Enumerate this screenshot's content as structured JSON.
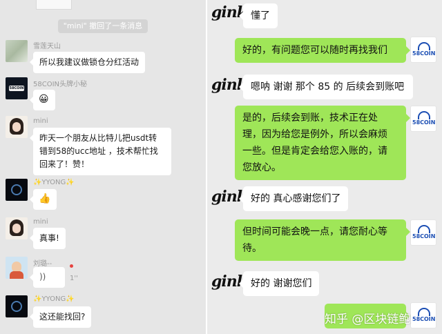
{
  "left": {
    "system_notice": "\"mini\" 撤回了一条消息",
    "messages": [
      {
        "sender": "雪莲天山",
        "text": "所以我建议做锁仓分红活动"
      },
      {
        "sender": "58COIN头牌小秘",
        "text": "😀"
      },
      {
        "sender": "mini",
        "lines": [
          "昨天一个朋友从比特儿把usdt转",
          "错到58的ucc地址 ，技术帮忙找",
          "回来了！赞！"
        ]
      },
      {
        "sender": "✨YYONG✨",
        "text": "👍"
      },
      {
        "sender": "mini",
        "text": "真事!"
      },
      {
        "sender": "刘璐--",
        "text": "))",
        "duration": "1''"
      },
      {
        "sender": "✨YYONG✨",
        "text": "这还能找回?"
      }
    ],
    "logo_text": "58COIN"
  },
  "right": {
    "customer_label": "gink",
    "support_avatar_text": "58COIN",
    "messages": [
      {
        "from": "customer",
        "text": "懂了"
      },
      {
        "from": "support",
        "text": "好的，有问题您可以随时再找我们"
      },
      {
        "from": "customer",
        "text": "嗯呐 谢谢 那个 85 的 后续会到账吧"
      },
      {
        "from": "support",
        "lines": [
          "是的，后续会到账，技术正在处",
          "理，因为给您是例外，所以会麻烦",
          "一些。但是肯定会给您入账的，请",
          "您放心。"
        ]
      },
      {
        "from": "customer",
        "text": "好的 真心感谢您们了"
      },
      {
        "from": "support",
        "lines": [
          "但时间可能会晚一点，请您耐心等",
          "待。"
        ]
      },
      {
        "from": "customer",
        "text": "好的 谢谢您们"
      }
    ],
    "watermark": "知乎 @区块链鲍"
  },
  "colors": {
    "left_bg": "#e6e6e6",
    "right_bg": "#ebebeb",
    "green_bubble": "#9fe658",
    "brand_blue": "#1a4db3"
  }
}
